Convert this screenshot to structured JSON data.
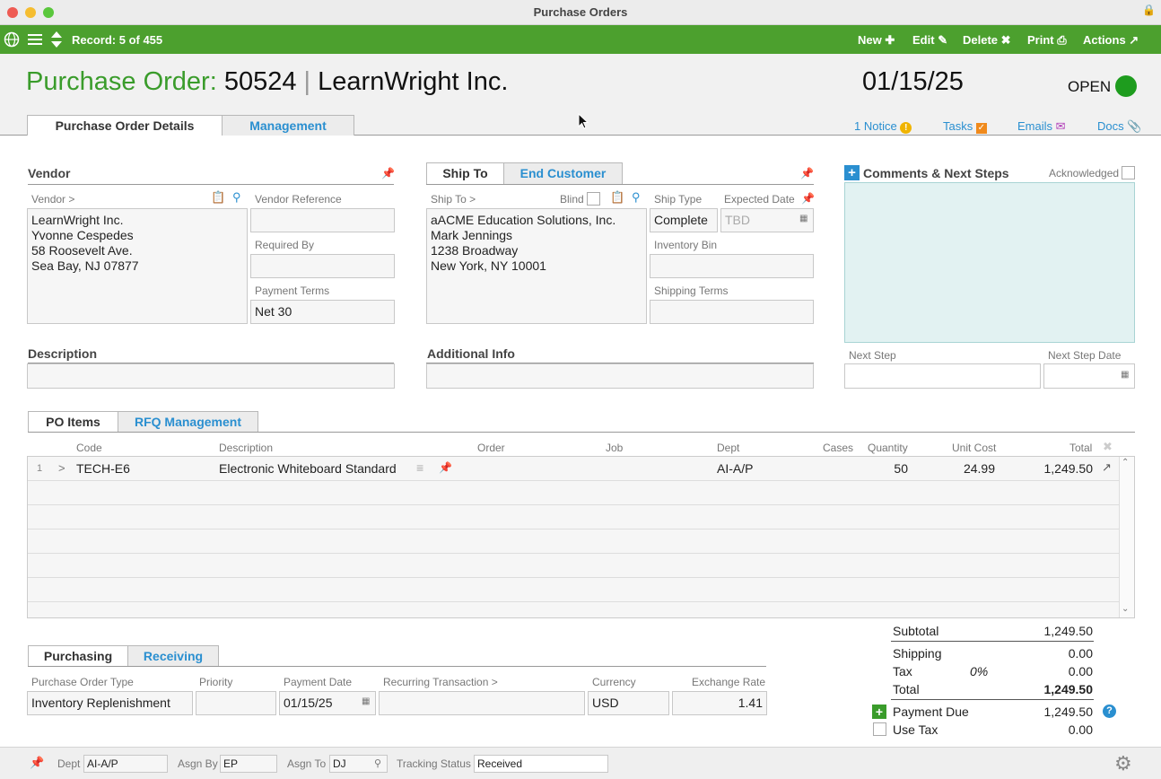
{
  "window": {
    "title": "Purchase Orders"
  },
  "toolbar": {
    "record": "Record: 5 of 455",
    "new": "New",
    "edit": "Edit",
    "delete": "Delete",
    "print": "Print",
    "actions": "Actions"
  },
  "header": {
    "po_label": "Purchase Order:",
    "po_number": "50524",
    "separator": "|",
    "vendor_name": "LearnWright Inc.",
    "date": "01/15/25",
    "status": "OPEN",
    "status_color": "#1e9c1e"
  },
  "tabs": {
    "details": "Purchase Order Details",
    "management": "Management"
  },
  "header_links": {
    "notice": "1 Notice",
    "tasks": "Tasks",
    "emails": "Emails",
    "docs": "Docs"
  },
  "vendor": {
    "section": "Vendor",
    "label": "Vendor >",
    "address": [
      "LearnWright Inc.",
      "Yvonne Cespedes",
      "58 Roosevelt Ave.",
      "Sea Bay, NJ 07877"
    ],
    "reference_label": "Vendor Reference",
    "reference": "",
    "required_by_label": "Required By",
    "required_by": "",
    "payment_terms_label": "Payment Terms",
    "payment_terms": "Net 30"
  },
  "ship": {
    "tab_ship_to": "Ship To",
    "tab_end_customer": "End Customer",
    "label": "Ship To >",
    "blind_label": "Blind",
    "address": [
      "aACME Education Solutions, Inc.",
      "Mark Jennings",
      "1238 Broadway",
      "New York, NY 10001"
    ],
    "ship_type_label": "Ship Type",
    "ship_type": "Complete",
    "expected_date_label": "Expected Date",
    "expected_date_placeholder": "TBD",
    "inventory_bin_label": "Inventory Bin",
    "shipping_terms_label": "Shipping Terms"
  },
  "comments": {
    "title": "Comments & Next Steps",
    "acknowledged_label": "Acknowledged",
    "next_step_label": "Next Step",
    "next_step_date_label": "Next Step Date"
  },
  "description": {
    "label": "Description"
  },
  "additional_info": {
    "label": "Additional Info"
  },
  "items_tabs": {
    "po_items": "PO Items",
    "rfq": "RFQ Management"
  },
  "items": {
    "columns": {
      "code": "Code",
      "description": "Description",
      "order": "Order",
      "job": "Job",
      "dept": "Dept",
      "cases": "Cases",
      "quantity": "Quantity",
      "unit_cost": "Unit Cost",
      "total": "Total"
    },
    "rows": [
      {
        "num": "1",
        "expand": ">",
        "code": "TECH-E6",
        "description": "Electronic Whiteboard Standard",
        "order": "",
        "job": "",
        "dept": "AI-A/P",
        "cases": "",
        "quantity": "50",
        "unit_cost": "24.99",
        "total": "1,249.50"
      }
    ]
  },
  "purchasing_tabs": {
    "purchasing": "Purchasing",
    "receiving": "Receiving"
  },
  "purchasing": {
    "type_label": "Purchase Order Type",
    "type": "Inventory Replenishment",
    "priority_label": "Priority",
    "priority": "",
    "payment_date_label": "Payment Date",
    "payment_date": "01/15/25",
    "recurring_label": "Recurring Transaction >",
    "recurring": "",
    "currency_label": "Currency",
    "currency": "USD",
    "exchange_rate_label": "Exchange Rate",
    "exchange_rate": "1.41"
  },
  "totals": {
    "subtotal_label": "Subtotal",
    "subtotal": "1,249.50",
    "shipping_label": "Shipping",
    "shipping": "0.00",
    "tax_label": "Tax",
    "tax_rate": "0%",
    "tax": "0.00",
    "total_label": "Total",
    "total": "1,249.50",
    "payment_due_label": "Payment Due",
    "payment_due": "1,249.50",
    "use_tax_label": "Use Tax",
    "use_tax": "0.00"
  },
  "statusbar": {
    "dept_label": "Dept",
    "dept": "AI-A/P",
    "asgn_by_label": "Asgn By",
    "asgn_by": "EP",
    "asgn_to_label": "Asgn To",
    "asgn_to": "DJ",
    "tracking_label": "Tracking Status",
    "tracking": "Received"
  },
  "colors": {
    "toolbar_green": "#4ca02e",
    "title_green": "#3a9c2b",
    "link_blue": "#2a8fd0",
    "comments_bg": "#e2f2f2"
  }
}
